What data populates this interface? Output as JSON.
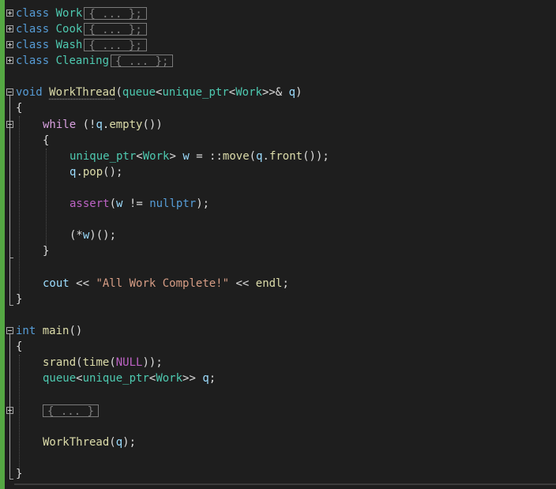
{
  "collapsed_classes": [
    {
      "keyword": "class",
      "name": "Work",
      "collapsed": "{ ... };"
    },
    {
      "keyword": "class",
      "name": "Cook",
      "collapsed": "{ ... };"
    },
    {
      "keyword": "class",
      "name": "Wash",
      "collapsed": "{ ... };"
    },
    {
      "keyword": "class",
      "name": "Cleaning",
      "collapsed": "{ ... };"
    }
  ],
  "workthread": {
    "ret": "void",
    "name": "WorkThread",
    "param_type1": "queue",
    "param_type2": "unique_ptr",
    "param_type3": "Work",
    "param_tail": ">>&",
    "param_name": "q",
    "open_brace": "{",
    "while_kw": "while",
    "while_cond_pre": "(!",
    "while_var": "q",
    "while_dot": ".",
    "while_fn": "empty",
    "while_cond_post": "())",
    "inner_open": "{",
    "l1_type1": "unique_ptr",
    "l1_type2": "Work",
    "l1_var": "w",
    "l1_eq": "= ::",
    "l1_fn": "move",
    "l1_arg_var": "q",
    "l1_fn2": "front",
    "l1_end": "());",
    "l2_var": "q",
    "l2_fn": "pop",
    "l2_end": "();",
    "l3_fn": "assert",
    "l3_var": "w",
    "l3_op": "!=",
    "l3_kw": "nullptr",
    "l3_end": ");",
    "l4_pre": "(*",
    "l4_var": "w",
    "l4_end": ")();",
    "inner_close": "}",
    "cout_var": "cout",
    "cout_op": "<<",
    "cout_str": "\"All Work Complete!\"",
    "cout_op2": "<<",
    "cout_endl": "endl",
    "cout_end": ";",
    "close_brace": "}"
  },
  "main": {
    "ret": "int",
    "name": "main",
    "parens": "()",
    "open_brace": "{",
    "srand_fn": "srand",
    "time_fn": "time",
    "null_macro": "NULL",
    "srand_end": "));",
    "q_type1": "queue",
    "q_type2": "unique_ptr",
    "q_type3": "Work",
    "q_tail": ">>",
    "q_var": "q",
    "q_end": ";",
    "collapsed_block": "{ ... }",
    "wt_fn": "WorkThread",
    "wt_var": "q",
    "wt_end": ");",
    "close_brace": "}"
  }
}
